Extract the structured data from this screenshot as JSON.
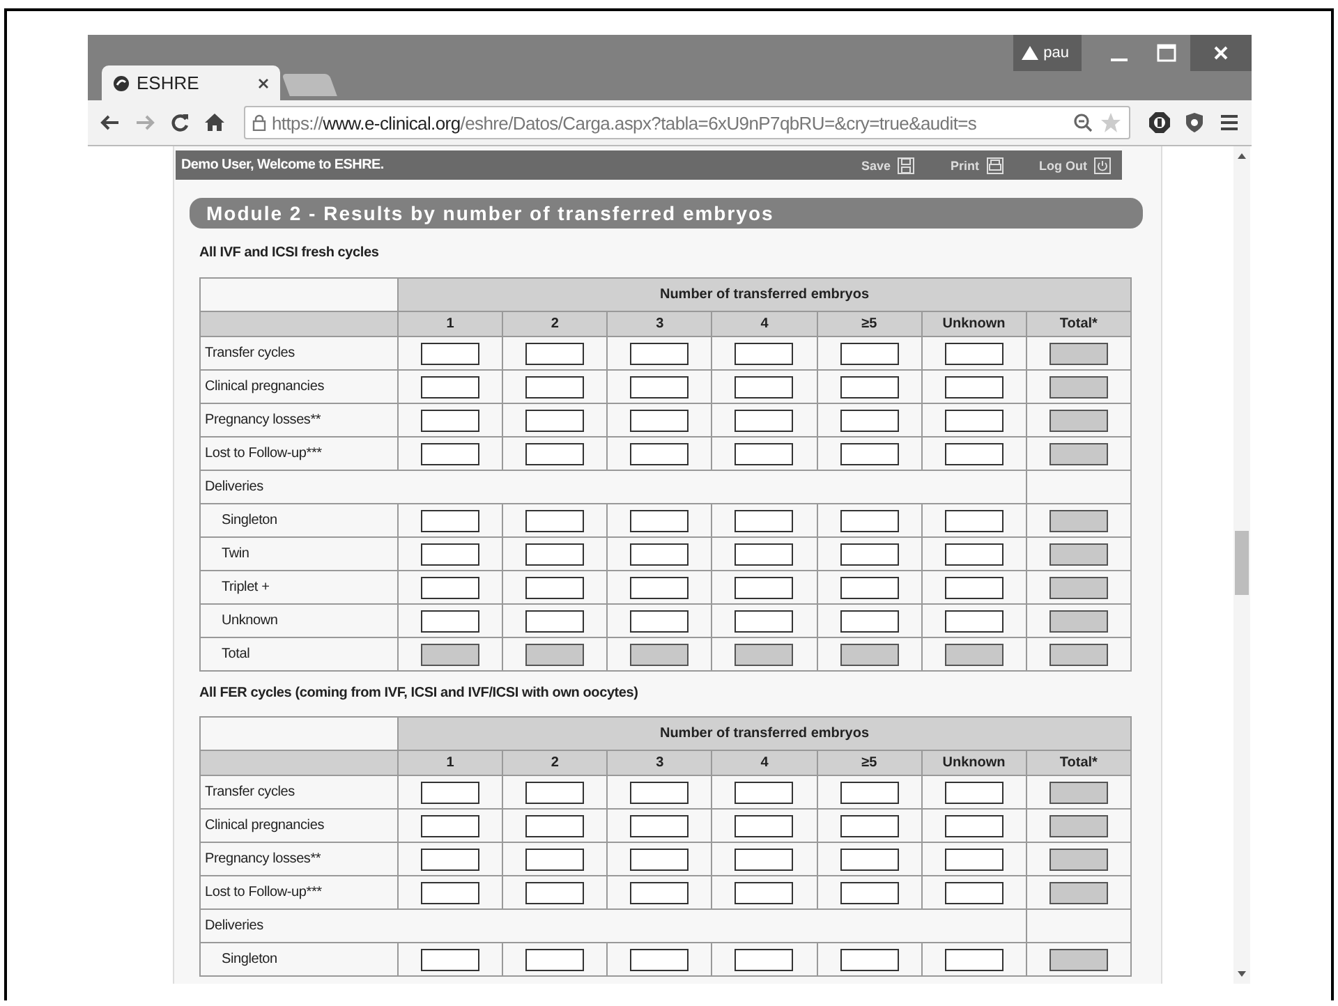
{
  "browser": {
    "tab": {
      "title": "ESHRE",
      "selected": true
    },
    "profile": "pau",
    "url": {
      "scheme": "https://",
      "host": "www.e-clinical.org",
      "path": "/eshre/Datos/Carga.aspx?tabla=6xU9nP7qbRU=&cry=true&audit=s"
    }
  },
  "topbar": {
    "welcome": "Demo User, Welcome to ESHRE.",
    "actions": [
      {
        "label": "Save",
        "kind": "save"
      },
      {
        "label": "Print",
        "kind": "print"
      },
      {
        "label": "Log Out",
        "kind": "logout"
      }
    ]
  },
  "module_title": "Module 2 - Results by number of transferred embryos",
  "sections": [
    {
      "title": "All IVF and ICSI fresh cycles",
      "group_header": "Number of transferred embryos",
      "columns": [
        "1",
        "2",
        "3",
        "4",
        "≥5",
        "Unknown",
        "Total*"
      ],
      "rows": [
        {
          "label": "Transfer cycles",
          "kind": "entry",
          "indented": false
        },
        {
          "label": "Clinical pregnancies",
          "kind": "entry",
          "indented": false
        },
        {
          "label": "Pregnancy losses**",
          "kind": "entry",
          "indented": false
        },
        {
          "label": "Lost to Follow-up***",
          "kind": "entry",
          "indented": false
        },
        {
          "label": "Deliveries",
          "kind": "group",
          "indented": false
        },
        {
          "label": "Singleton",
          "kind": "entry",
          "indented": true
        },
        {
          "label": "Twin",
          "kind": "entry",
          "indented": true
        },
        {
          "label": "Triplet +",
          "kind": "entry",
          "indented": true
        },
        {
          "label": "Unknown",
          "kind": "entry",
          "indented": true
        },
        {
          "label": "Total",
          "kind": "total",
          "indented": true
        }
      ]
    },
    {
      "title": "All FER cycles (coming from IVF, ICSI and IVF/ICSI with own oocytes)",
      "group_header": "Number of transferred embryos",
      "columns": [
        "1",
        "2",
        "3",
        "4",
        "≥5",
        "Unknown",
        "Total*"
      ],
      "rows": [
        {
          "label": "Transfer cycles",
          "kind": "entry",
          "indented": false
        },
        {
          "label": "Clinical pregnancies",
          "kind": "entry",
          "indented": false
        },
        {
          "label": "Pregnancy losses**",
          "kind": "entry",
          "indented": false
        },
        {
          "label": "Lost to Follow-up***",
          "kind": "entry",
          "indented": false
        },
        {
          "label": "Deliveries",
          "kind": "group",
          "indented": false
        },
        {
          "label": "Singleton",
          "kind": "entry",
          "indented": true
        }
      ]
    }
  ]
}
